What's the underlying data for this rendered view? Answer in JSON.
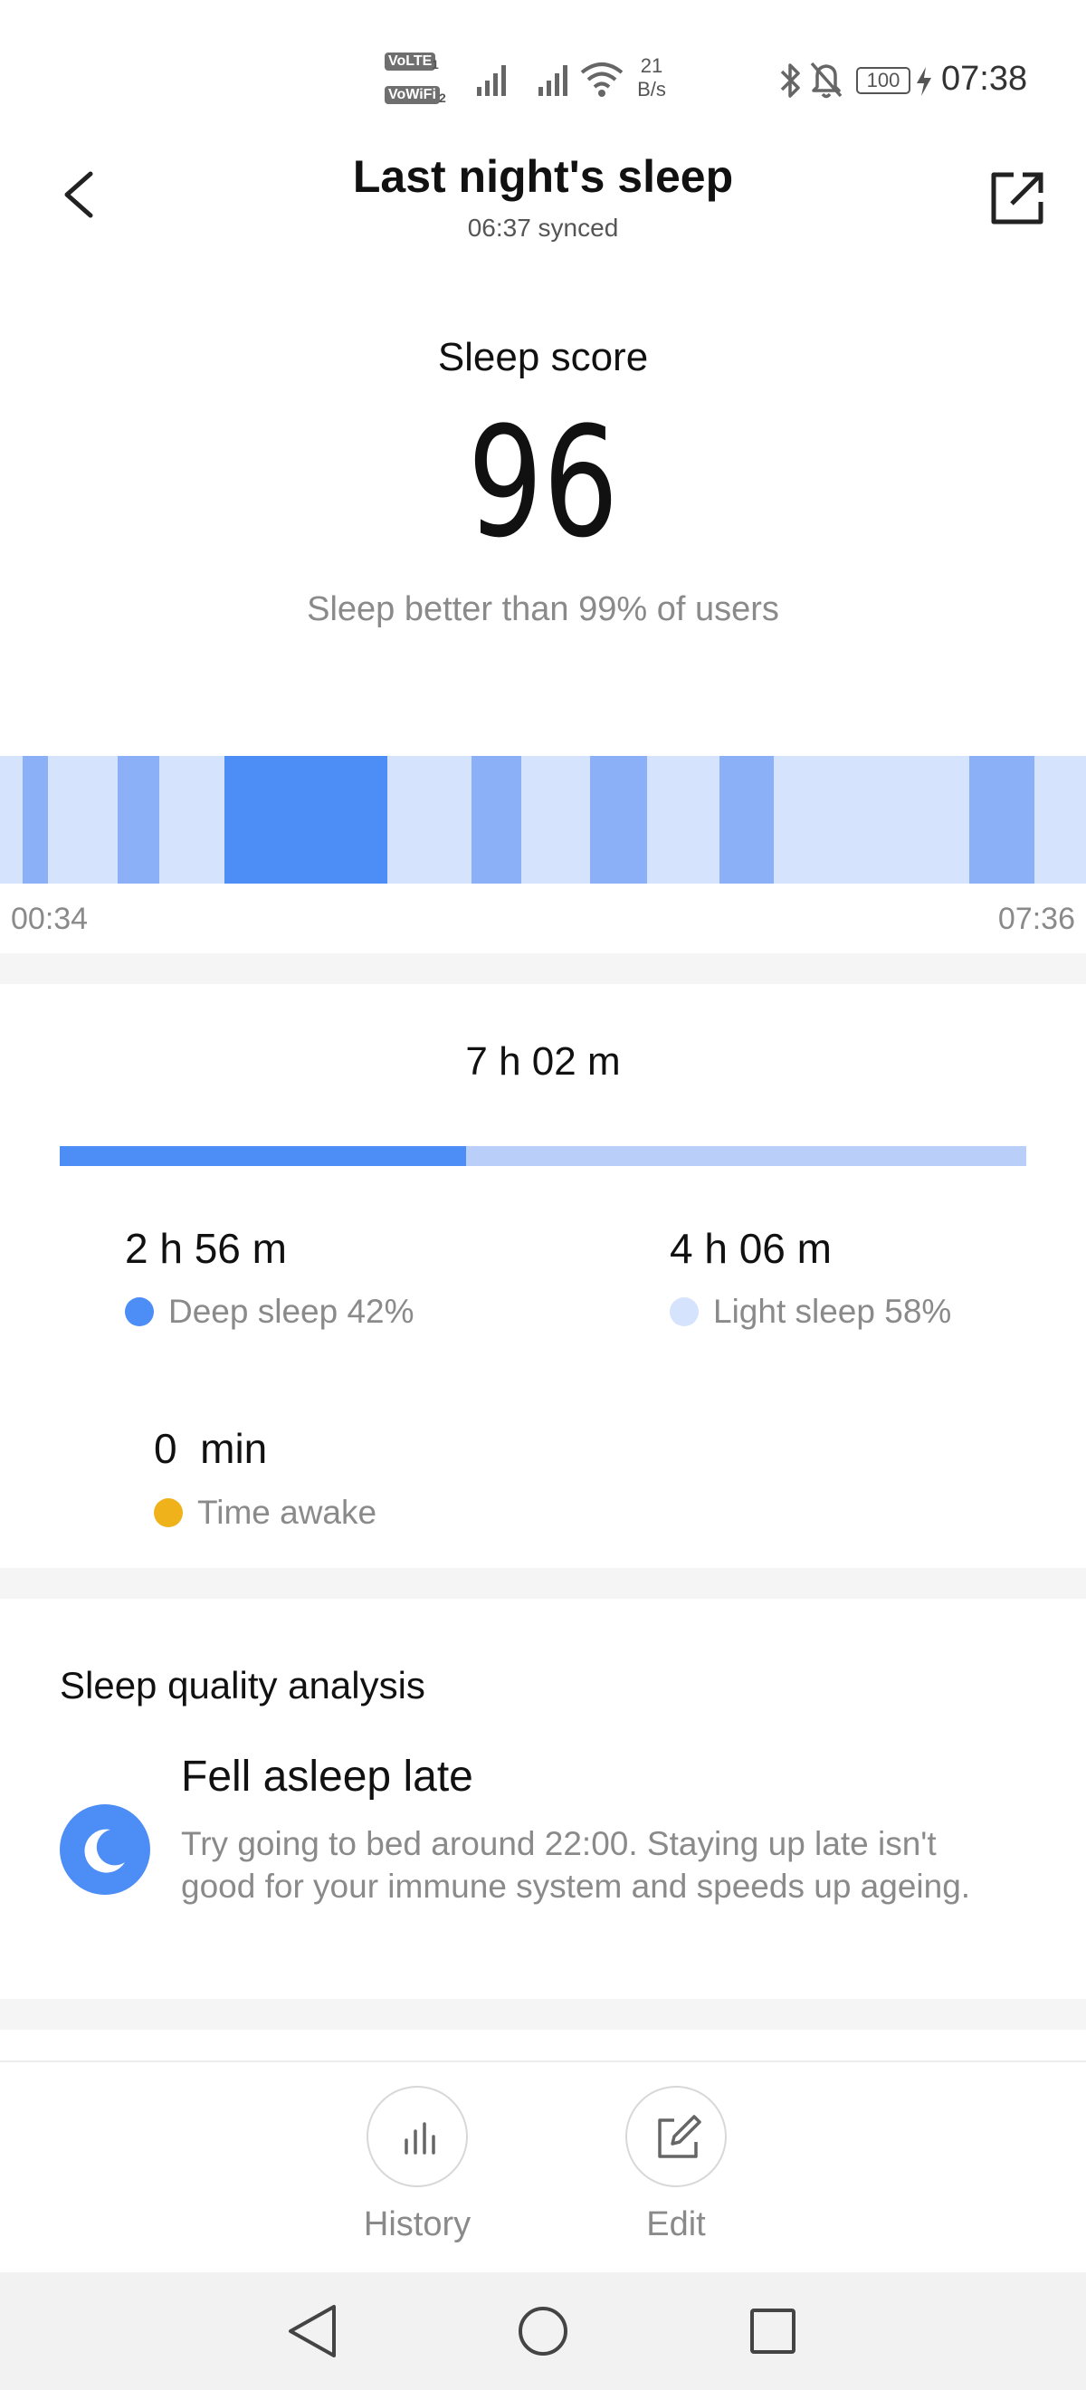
{
  "status_bar": {
    "volte_label": "VoLTE",
    "vowifi_label": "VoWiFi",
    "sim1": "1",
    "sim2": "2",
    "net_speed_value": "21",
    "net_speed_unit": "B/s",
    "battery": "100",
    "time": "07:38",
    "icons": [
      "signal-icon",
      "wifi-icon",
      "bluetooth-icon",
      "mute-bell-icon",
      "battery-icon",
      "charging-icon"
    ]
  },
  "header": {
    "title": "Last night's sleep",
    "synced": "06:37 synced",
    "back_icon": "chevron-left-icon",
    "share_icon": "share-icon"
  },
  "score": {
    "label": "Sleep score",
    "value": "96",
    "comparison": "Sleep better than 99% of users"
  },
  "timeline": {
    "start": "00:34",
    "end": "07:36",
    "colors": {
      "light": "#d6e3fd",
      "deep": "#4c8df6",
      "deep_medium": "#8bb0f7"
    }
  },
  "summary": {
    "total": "7 h 02 m",
    "deep_fraction": 0.42,
    "deep": {
      "value": "2 h 56 m",
      "label": "Deep sleep 42%",
      "color": "#4c8df6"
    },
    "light": {
      "value": "4 h 06 m",
      "label": "Light sleep 58%",
      "color": "#d6e3fd"
    },
    "awake": {
      "value": "0  min",
      "label": "Time awake",
      "color": "#f0b21b"
    }
  },
  "analysis": {
    "section_title": "Sleep quality analysis",
    "icon": "moon-icon",
    "title": "Fell asleep late",
    "text": "Try going to bed around 22:00. Staying up late isn't good for your immune system and speeds up ageing."
  },
  "actions": {
    "history_label": "History",
    "history_icon": "bar-chart-icon",
    "edit_label": "Edit",
    "edit_icon": "edit-icon"
  },
  "nav": {
    "back_icon": "nav-back-icon",
    "home_icon": "nav-home-icon",
    "recents_icon": "nav-recents-icon"
  }
}
